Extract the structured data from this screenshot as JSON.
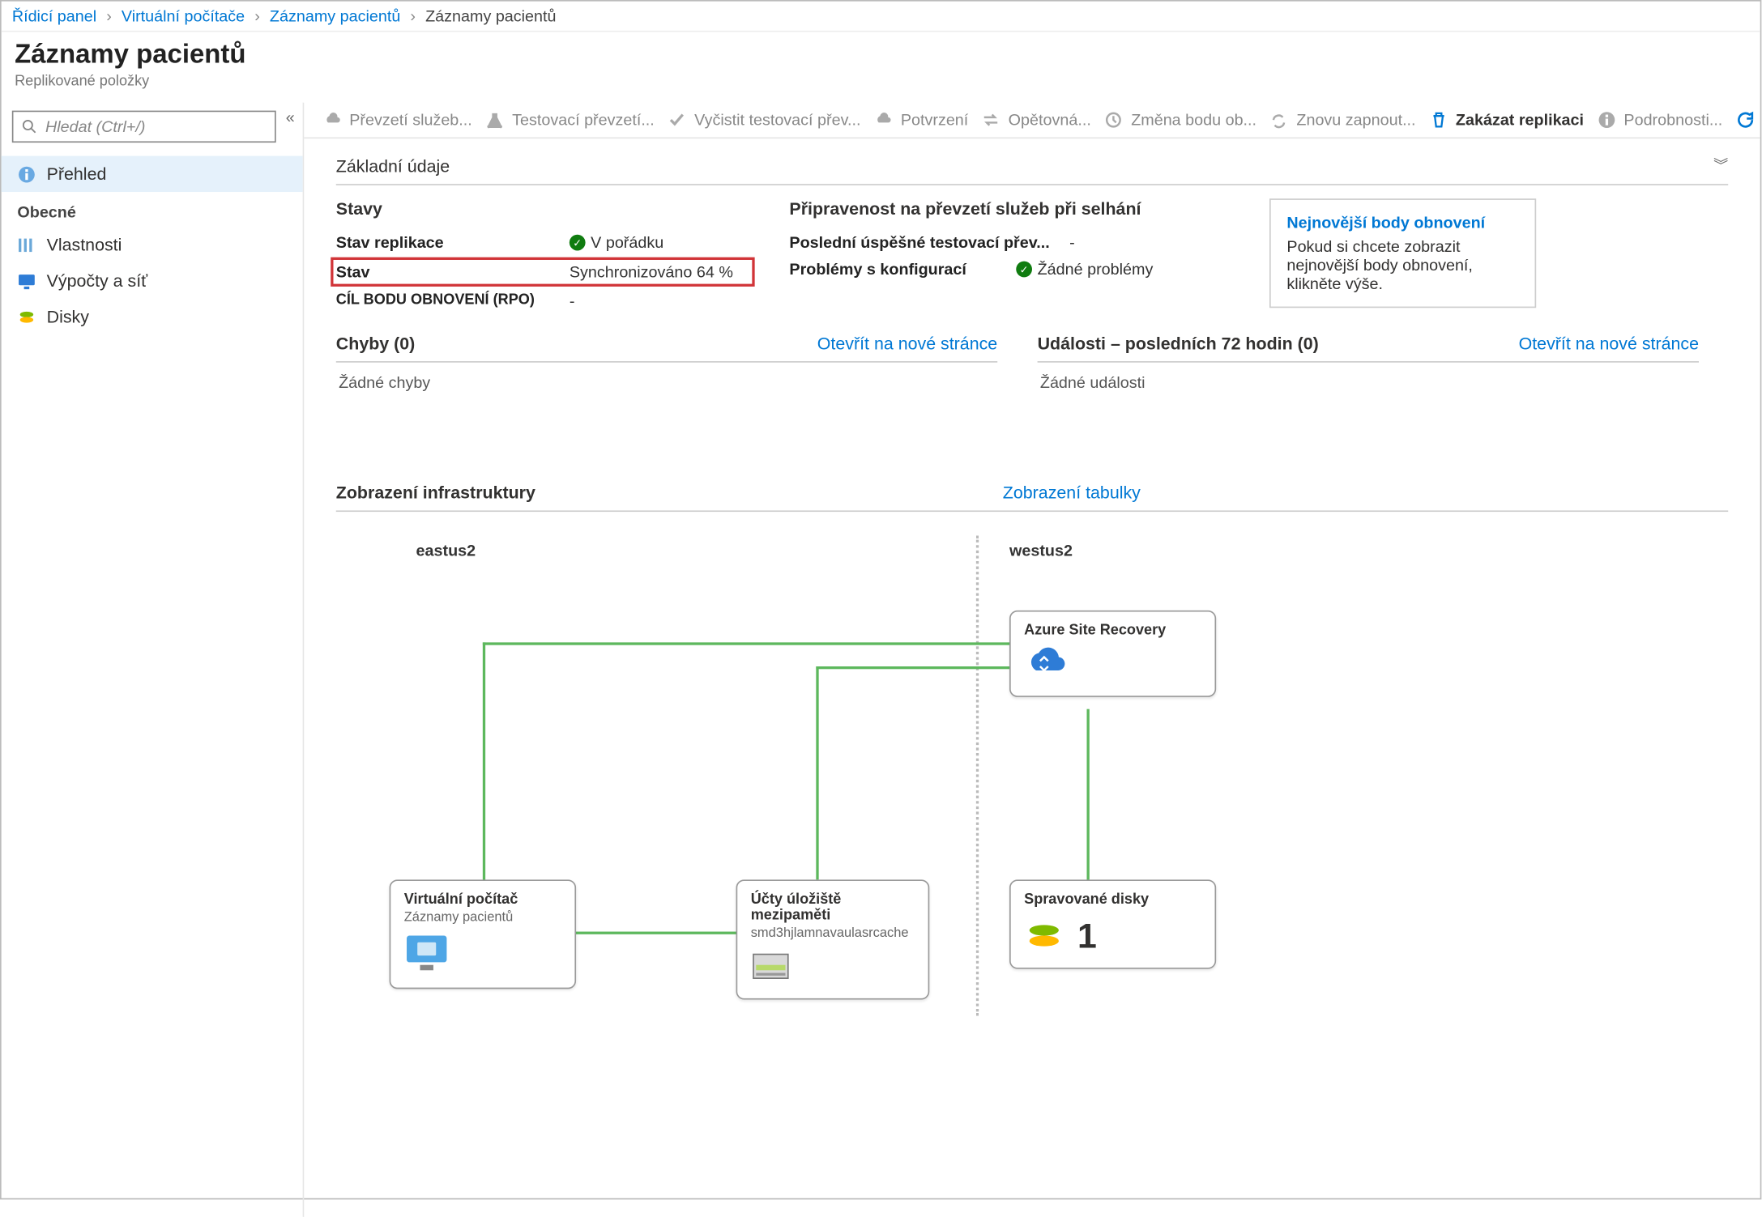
{
  "breadcrumb": {
    "items": [
      "Řídicí panel",
      "Virtuální počítače",
      "Záznamy pacientů"
    ],
    "current": "Záznamy pacientů"
  },
  "header": {
    "title": "Záznamy pacientů",
    "subtitle": "Replikované položky"
  },
  "sidebar": {
    "search_placeholder": "Hledat (Ctrl+/)",
    "items": [
      {
        "label": "Přehled",
        "active": true
      },
      {
        "section": "Obecné"
      },
      {
        "label": "Vlastnosti"
      },
      {
        "label": "Výpočty a síť"
      },
      {
        "label": "Disky"
      }
    ]
  },
  "toolbar": {
    "buttons": [
      {
        "label": "Převzetí služeb..."
      },
      {
        "label": "Testovací převzetí..."
      },
      {
        "label": "Vyčistit testovací přev..."
      },
      {
        "label": "Potvrzení"
      },
      {
        "label": "Opětovná..."
      },
      {
        "label": "Změna bodu ob..."
      },
      {
        "label": "Znovu zapnout..."
      },
      {
        "label": "Zakázat replikaci",
        "primary": true
      },
      {
        "label": "Podrobnosti..."
      },
      {
        "label": "Obnovit",
        "enabled": true
      }
    ]
  },
  "essentials": {
    "heading": "Základní údaje",
    "states_title": "Stavy",
    "replication_state_k": "Stav replikace",
    "replication_state_v": "V pořádku",
    "state_k": "Stav",
    "state_v": "Synchronizováno 64 %",
    "rpo_k": "CÍL BODU OBNOVENÍ (RPO)",
    "rpo_v": "-",
    "readiness_title": "Připravenost na převzetí služeb při selhání",
    "last_test_k": "Poslední úspěšné testovací přev...",
    "last_test_v": "-",
    "config_k": "Problémy s konfigurací",
    "config_v": "Žádné problémy",
    "recovery": {
      "title": "Nejnovější body obnovení",
      "text": "Pokud si chcete zobrazit nejnovější body obnovení, klikněte výše."
    }
  },
  "errors_panel": {
    "title": "Chyby (0)",
    "link": "Otevřít na nové stránce",
    "empty": "Žádné chyby"
  },
  "events_panel": {
    "title": "Události – posledních 72 hodin (0)",
    "link": "Otevřít na nové stránce",
    "empty": "Žádné události"
  },
  "infra": {
    "view_label": "Zobrazení infrastruktury",
    "table_link": "Zobrazení tabulky",
    "region_left": "eastus2",
    "region_right": "westus2",
    "vm": {
      "title": "Virtuální počítač",
      "sub": "Záznamy pacientů"
    },
    "cache": {
      "title": "Účty úložiště mezipaměti",
      "sub": "smd3hjlamnavaulasrcache"
    },
    "asr": {
      "title": "Azure Site Recovery"
    },
    "disks": {
      "title": "Spravované disky",
      "count": "1"
    }
  }
}
